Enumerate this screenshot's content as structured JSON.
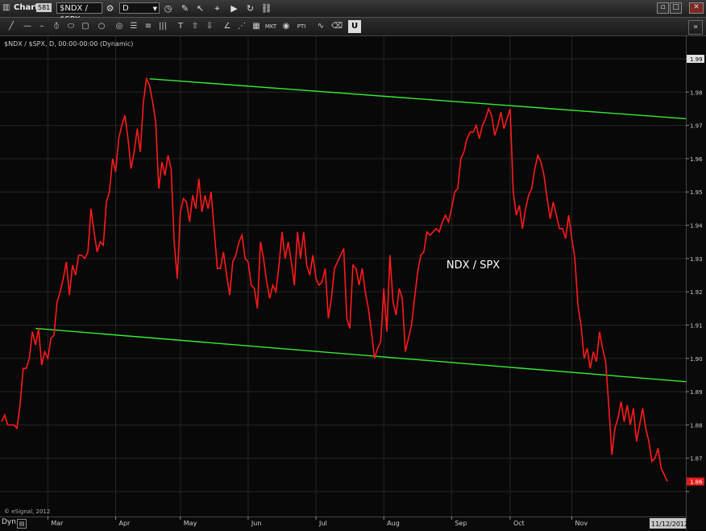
{
  "window": {
    "title": "Chart",
    "badge": "581",
    "symbol": "$NDX / $SPX",
    "interval": "D"
  },
  "toolbar": {
    "tools": [
      "line-tool",
      "horizontal-line-tool",
      "fib-tool",
      "ellipse-tool",
      "rectangle-tool",
      "circle-tool",
      "lines-tool",
      "list-tool",
      "bars-tool",
      "text-tool",
      "up-arrow-tool",
      "down-arrow-tool",
      "trend-tool",
      "grid-tool",
      "mkt-tool",
      "eye-tool",
      "pti-tool",
      "wave-tool",
      "pencil-tool",
      "u-tool"
    ],
    "tool_labels": {
      "mkt": "MKT",
      "pti": "PTI"
    },
    "collapse_label": "»"
  },
  "chart_header": "$NDX / $SPX, D, 00:00-00:00 (Dynamic)",
  "copyright": "© eSignal, 2012",
  "dyn_label": "Dyn",
  "chart_data": {
    "type": "line",
    "title": "NDX / SPX",
    "ylim": [
      1.855,
      1.995
    ],
    "yticks": [
      1.86,
      1.87,
      1.88,
      1.89,
      1.9,
      1.91,
      1.92,
      1.93,
      1.94,
      1.95,
      1.96,
      1.97,
      1.98,
      1.99
    ],
    "ytick_labels": [
      "1.86",
      "1.87",
      "1.88",
      "1.89",
      "1.90",
      "1.91",
      "1.92",
      "1.93",
      "1.94",
      "1.95",
      "1.96",
      "1.97",
      "1.98",
      "1.99"
    ],
    "x_tick_labels": [
      "Mar",
      "Apr",
      "May",
      "Jun",
      "Jul",
      "Aug",
      "Sep",
      "Oct",
      "Nov"
    ],
    "x_tick_index": [
      15,
      37,
      58,
      80,
      102,
      124,
      146,
      165,
      185
    ],
    "current_date": "11/12/2012",
    "last_value": "1.86",
    "top_value": "1.99",
    "series": [
      {
        "name": "",
        "color": "#ff1a1a",
        "values": [
          1.881,
          1.883,
          1.88,
          1.88,
          1.88,
          1.879,
          1.886,
          1.897,
          1.897,
          1.9,
          1.908,
          1.904,
          1.909,
          1.898,
          1.902,
          1.9,
          1.906,
          1.907,
          1.917,
          1.92,
          1.924,
          1.929,
          1.919,
          1.928,
          1.925,
          1.931,
          1.931,
          1.93,
          1.932,
          1.945,
          1.938,
          1.932,
          1.935,
          1.934,
          1.947,
          1.95,
          1.96,
          1.956,
          1.966,
          1.97,
          1.973,
          1.966,
          1.957,
          1.962,
          1.969,
          1.962,
          1.977,
          1.984,
          1.982,
          1.977,
          1.971,
          1.951,
          1.959,
          1.955,
          1.961,
          1.957,
          1.935,
          1.924,
          1.944,
          1.948,
          1.947,
          1.941,
          1.949,
          1.945,
          1.954,
          1.944,
          1.949,
          1.945,
          1.95,
          1.938,
          1.927,
          1.927,
          1.932,
          1.925,
          1.919,
          1.929,
          1.931,
          1.935,
          1.937,
          1.93,
          1.929,
          1.922,
          1.921,
          1.915,
          1.935,
          1.93,
          1.923,
          1.918,
          1.922,
          1.92,
          1.928,
          1.938,
          1.93,
          1.935,
          1.929,
          1.922,
          1.938,
          1.93,
          1.938,
          1.928,
          1.925,
          1.931,
          1.924,
          1.922,
          1.923,
          1.927,
          1.912,
          1.918,
          1.927,
          1.929,
          1.931,
          1.933,
          1.912,
          1.909,
          1.928,
          1.927,
          1.922,
          1.927,
          1.92,
          1.915,
          1.908,
          1.9,
          1.903,
          1.905,
          1.921,
          1.908,
          1.931,
          1.917,
          1.913,
          1.921,
          1.918,
          1.902,
          1.906,
          1.91,
          1.918,
          1.926,
          1.931,
          1.932,
          1.938,
          1.937,
          1.938,
          1.939,
          1.938,
          1.941,
          1.943,
          1.941,
          1.945,
          1.95,
          1.951,
          1.96,
          1.962,
          1.966,
          1.968,
          1.968,
          1.97,
          1.966,
          1.97,
          1.972,
          1.975,
          1.973,
          1.967,
          1.97,
          1.974,
          1.969,
          1.972,
          1.975,
          1.95,
          1.943,
          1.946,
          1.939,
          1.945,
          1.949,
          1.951,
          1.957,
          1.961,
          1.959,
          1.955,
          1.948,
          1.942,
          1.947,
          1.943,
          1.939,
          1.939,
          1.936,
          1.943,
          1.936,
          1.93,
          1.916,
          1.91,
          1.9,
          1.903,
          1.897,
          1.902,
          1.899,
          1.908,
          1.903,
          1.899,
          1.886,
          1.871,
          1.879,
          1.882,
          1.887,
          1.881,
          1.886,
          1.88,
          1.885,
          1.875,
          1.88,
          1.885,
          1.879,
          1.875,
          1.869,
          1.87,
          1.873,
          1.867,
          1.865,
          1.863
        ]
      }
    ],
    "trendlines": [
      {
        "name": "upper-channel",
        "color": "#33ee33",
        "from": {
          "index": 48,
          "value": 1.984
        },
        "to": {
          "index": 237,
          "value": 1.972
        }
      },
      {
        "name": "lower-channel",
        "color": "#33ee33",
        "from": {
          "index": 11,
          "value": 1.909
        },
        "to": {
          "index": 237,
          "value": 1.893
        }
      }
    ],
    "annotations": [
      {
        "text": "NDX / SPX",
        "color": "#ffffff",
        "index": 153,
        "value": 1.927
      }
    ],
    "grid": true
  }
}
